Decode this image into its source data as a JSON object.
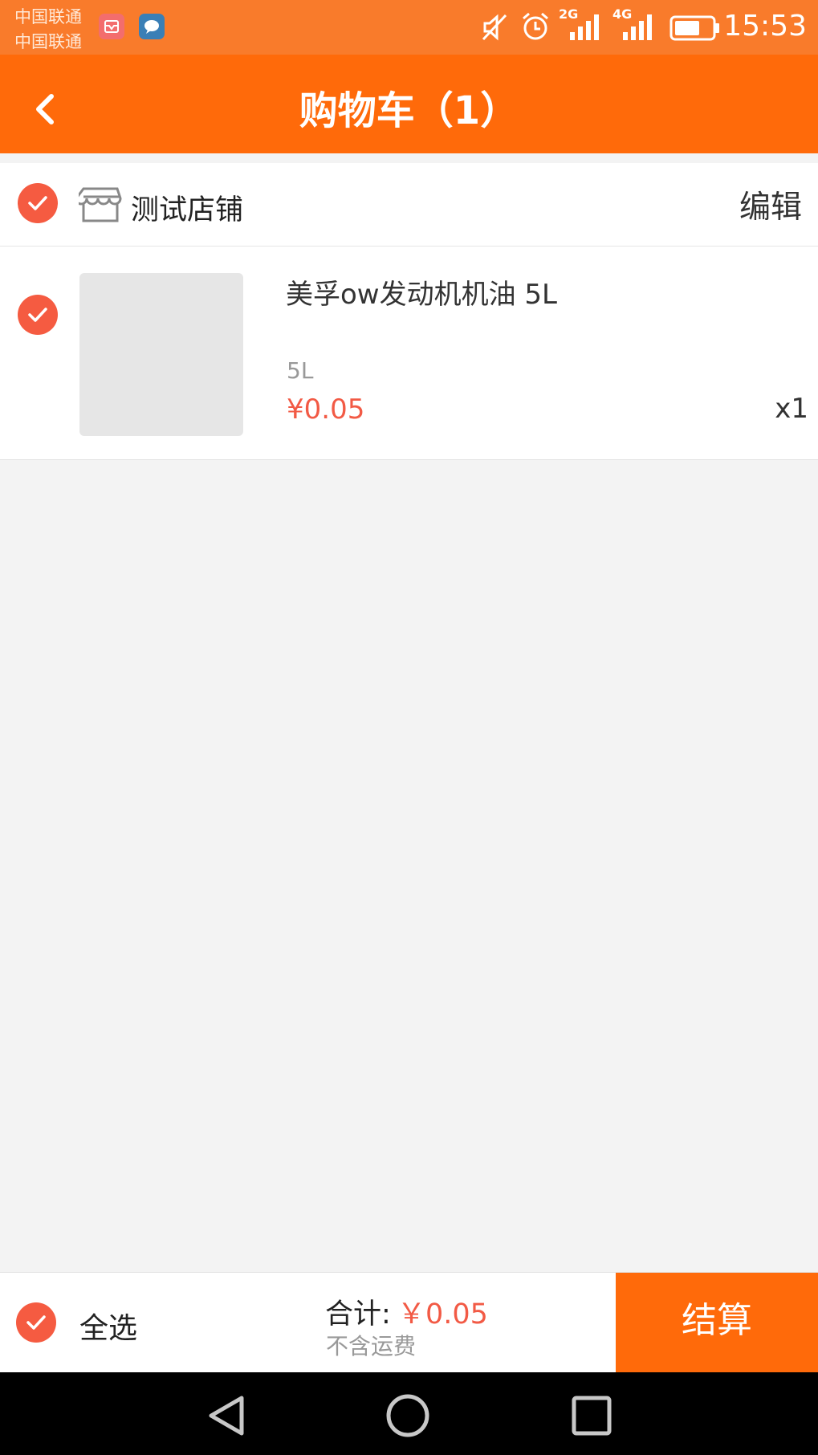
{
  "status_bar": {
    "carrier_1": "中国联通",
    "carrier_2": "中国联通",
    "network_1": "2G",
    "network_2": "4G",
    "time": "15:53"
  },
  "header": {
    "title": "购物车（1）"
  },
  "shop": {
    "name": "测试店铺",
    "edit_label": "编辑"
  },
  "cart_items": [
    {
      "name": "美孚ow发动机机油 5L",
      "spec": "5L",
      "price": "¥0.05",
      "quantity": "x1"
    }
  ],
  "footer": {
    "select_all_label": "全选",
    "total_label": "合计:",
    "total_value": "￥0.05",
    "shipping_note": "不含运费",
    "checkout_label": "结算"
  },
  "colors": {
    "accent": "#ff6a0a",
    "check": "#f55b41",
    "price": "#f25a45"
  }
}
